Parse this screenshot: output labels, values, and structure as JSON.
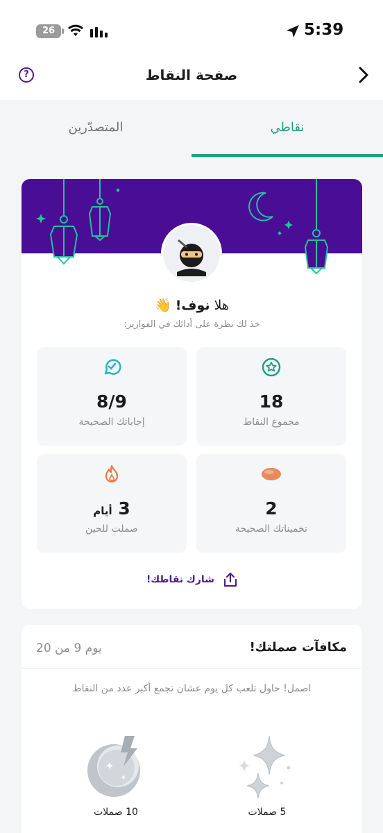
{
  "status_bar": {
    "battery": "26",
    "time": "5:39"
  },
  "header": {
    "title": "صفحة النقاط",
    "help_icon": "?"
  },
  "tabs": {
    "active": "نقاطي",
    "inactive": "المتصدّرين"
  },
  "colors": {
    "purple": "#4a0d96",
    "green": "#1aa37d",
    "orange": "#f07a4a"
  },
  "profile": {
    "greeting_prefix": "هلا ",
    "name": "نوف!",
    "wave": "👋",
    "subtitle": "خذ لك نظرة على أدائك في الفوازير:",
    "avatar_icon": "ninja-avatar-icon"
  },
  "stats": {
    "total_points": {
      "value": "18",
      "label": "مجموع النقاط",
      "icon": "star-badge-icon"
    },
    "correct_answers": {
      "value": "8/9",
      "label": "إجاباتك الصحيحة",
      "icon": "check-bubble-icon"
    },
    "correct_guesses": {
      "value": "2",
      "label": "تخميناتك الصحيحة",
      "icon": "date-pill-icon"
    },
    "streak": {
      "value": "3",
      "unit": "أيام",
      "label": "صملت للحين",
      "icon": "flame-icon"
    }
  },
  "share": {
    "label": "شارك نقاطك!",
    "icon": "share-icon"
  },
  "rewards": {
    "title": "مكافآت صملتك!",
    "day": "يوم 9 من 20",
    "hint": "اصمل! حاول تلعب كل يوم عشان تجمع أكبر عدد من النقاط",
    "badges": [
      {
        "label": "5 صملات",
        "icon": "sparkles-icon"
      },
      {
        "label": "10 صملات",
        "icon": "moon-lightning-icon"
      }
    ]
  }
}
